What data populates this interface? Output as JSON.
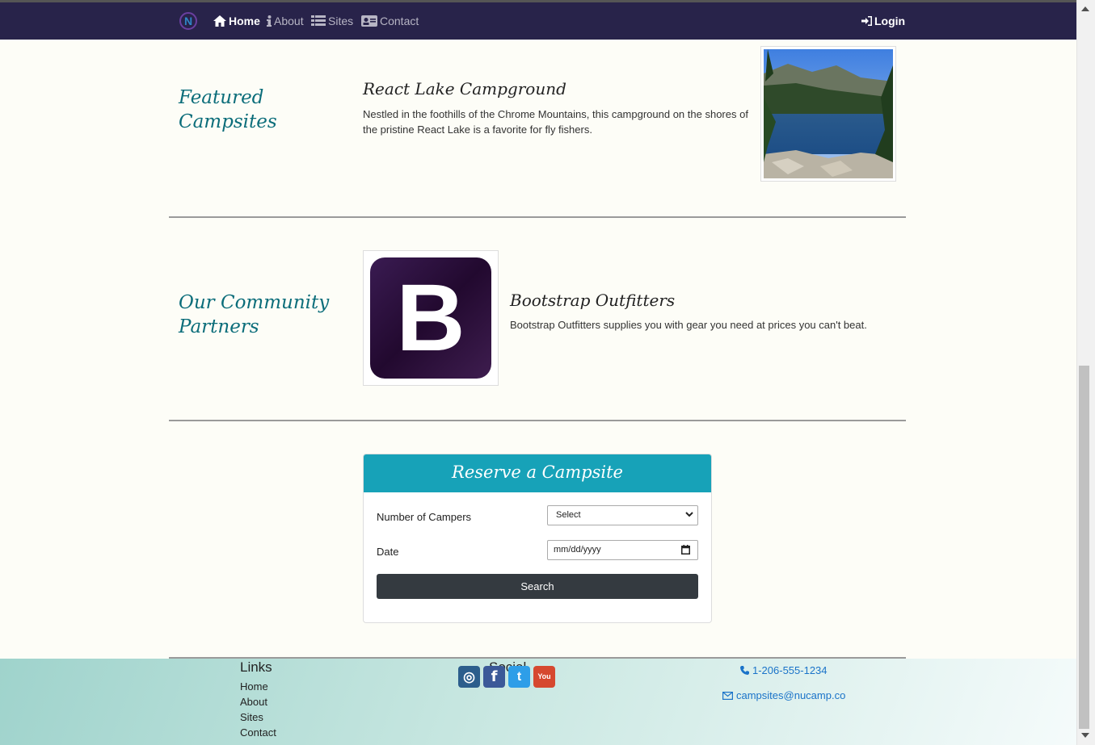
{
  "nav": {
    "logo_text": "N",
    "items": [
      {
        "label": "Home",
        "icon": "home-icon",
        "active": true
      },
      {
        "label": "About",
        "icon": "info-icon",
        "active": false
      },
      {
        "label": "Sites",
        "icon": "list-icon",
        "active": false
      },
      {
        "label": "Contact",
        "icon": "address-card-icon",
        "active": false
      }
    ],
    "login_label": "Login",
    "login_icon": "sign-in-icon"
  },
  "featured": {
    "heading_line1": "Featured",
    "heading_line2": "Campsites",
    "site_name": "React Lake Campground",
    "site_description": "Nestled in the foothills of the Chrome Mountains, this campground on the shores of the pristine React Lake is a favorite for fly fishers."
  },
  "partners": {
    "heading_line1": "Our Community",
    "heading_line2": "Partners",
    "partner_logo_text": "B",
    "partner_name": "Bootstrap Outfitters",
    "partner_description": "Bootstrap Outfitters supplies you with gear you need at prices you can't beat."
  },
  "reserve": {
    "title": "Reserve a Campsite",
    "campers_label": "Number of Campers",
    "campers_value": "Select",
    "date_label": "Date",
    "date_value": "mm/dd/yyyy",
    "search_label": "Search"
  },
  "footer": {
    "links_title": "Links",
    "links": [
      "Home",
      "About",
      "Sites",
      "Contact"
    ],
    "social_title": "Social",
    "social": [
      {
        "name": "instagram-icon",
        "glyph": "◎",
        "color": "#2c5e8c"
      },
      {
        "name": "facebook-icon",
        "glyph": "f",
        "color": "#3b5998"
      },
      {
        "name": "twitter-icon",
        "glyph": "t",
        "color": "#2e9ee8"
      },
      {
        "name": "youtube-icon",
        "glyph": "You",
        "color": "#d6482f"
      }
    ],
    "phone": "1-206-555-1234",
    "email": "campsites@nucamp.co"
  },
  "colors": {
    "navbar": "#28234a",
    "heading_teal": "#0b6d7a",
    "card_header": "#17a2b8",
    "button_dark": "#343a40",
    "link_blue": "#1a73c9"
  }
}
